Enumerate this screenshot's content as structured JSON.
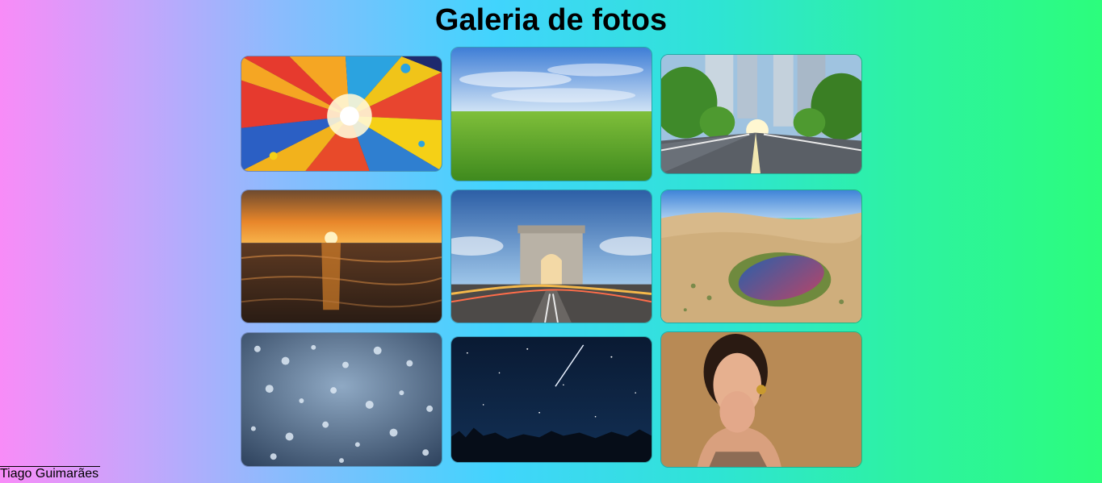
{
  "page": {
    "title": "Galeria de fotos"
  },
  "gallery": {
    "photos": [
      {
        "subject": "abstract-color-splash"
      },
      {
        "subject": "green-field-blue-sky"
      },
      {
        "subject": "city-road-trees"
      },
      {
        "subject": "ocean-sunset"
      },
      {
        "subject": "arc-de-triomphe"
      },
      {
        "subject": "desert-oasis-lake"
      },
      {
        "subject": "rain-drops-glass"
      },
      {
        "subject": "night-sky-shooting-star"
      },
      {
        "subject": "woman-portrait"
      }
    ]
  },
  "footer": {
    "author": "Tiago Guimarães"
  }
}
